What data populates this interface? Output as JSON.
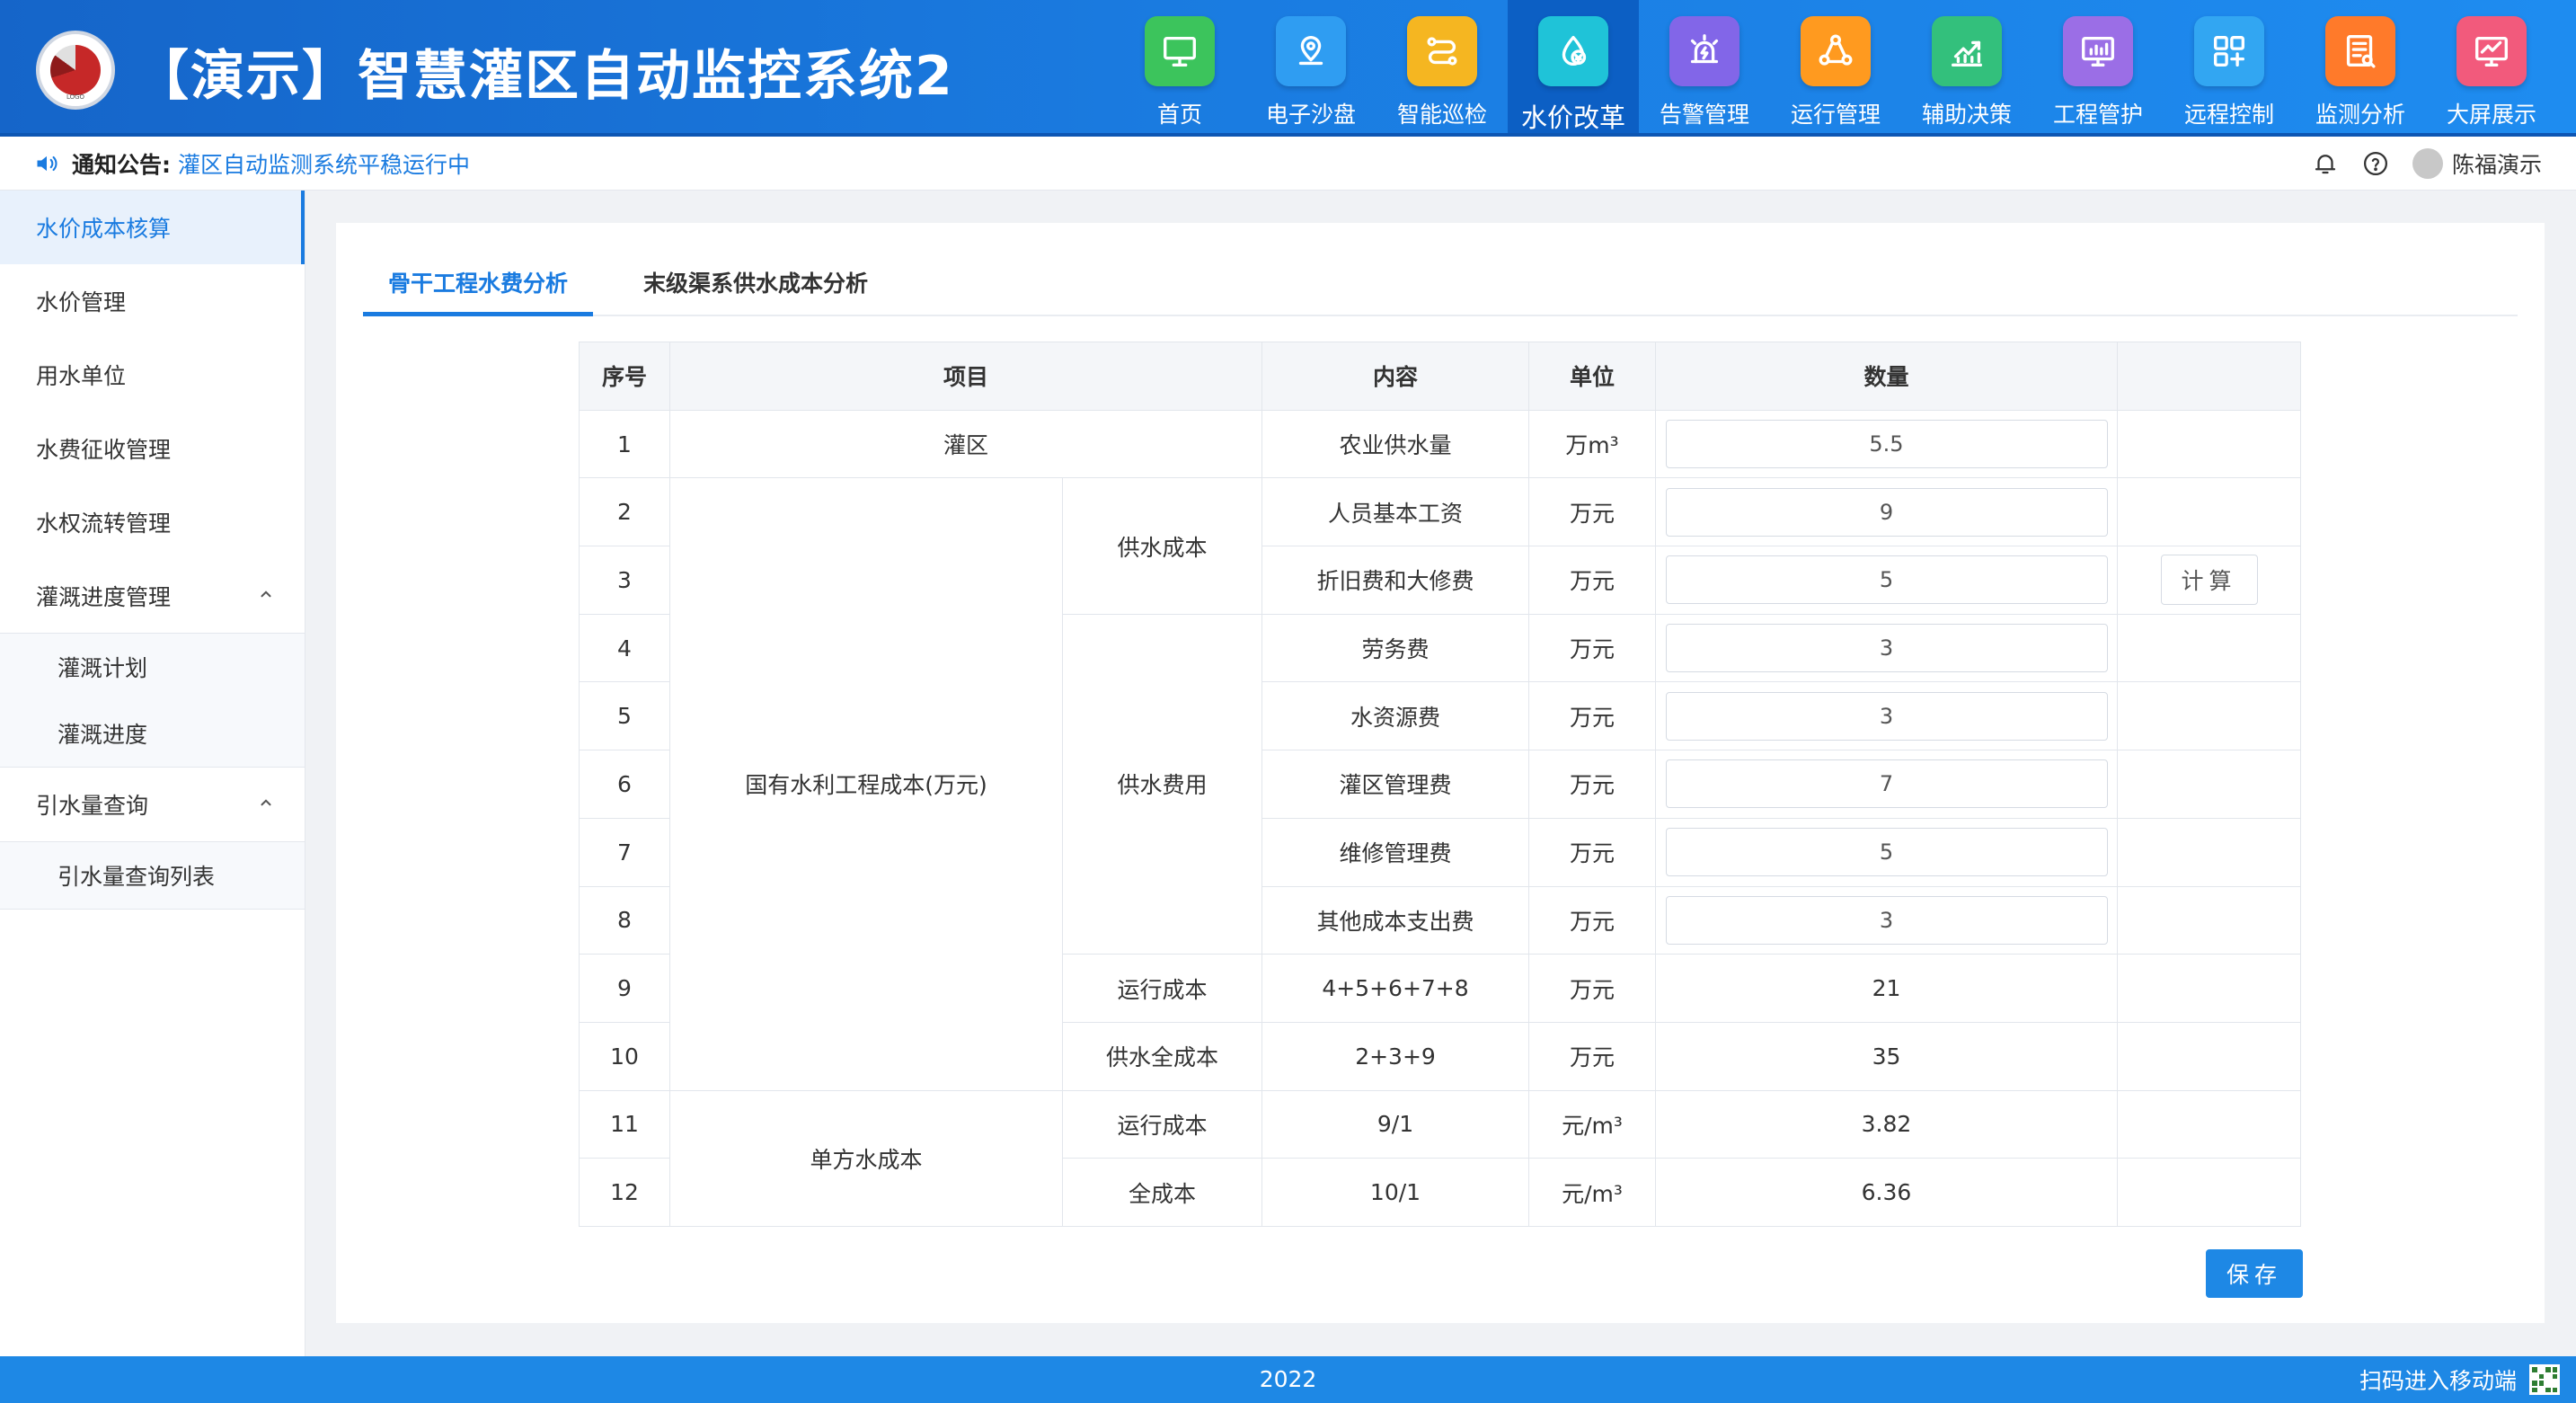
{
  "header": {
    "app_title": "【演示】智慧灌区自动监控系统2",
    "nav": [
      {
        "label": "首页",
        "icon": "monitor-icon",
        "color": "#3cc45c"
      },
      {
        "label": "电子沙盘",
        "icon": "map-pin-icon",
        "color": "#2f9df2"
      },
      {
        "label": "智能巡检",
        "icon": "route-icon",
        "color": "#f5b621"
      },
      {
        "label": "水价改革",
        "icon": "water-price-icon",
        "color": "#1fc3d8",
        "active": true
      },
      {
        "label": "告警管理",
        "icon": "alarm-icon",
        "color": "#8266e8"
      },
      {
        "label": "运行管理",
        "icon": "nodes-icon",
        "color": "#ff9a1f"
      },
      {
        "label": "辅助决策",
        "icon": "chart-up-icon",
        "color": "#33c07c"
      },
      {
        "label": "工程管护",
        "icon": "dashboard-screen-icon",
        "color": "#9b6ee6"
      },
      {
        "label": "远程控制",
        "icon": "remote-control-icon",
        "color": "#32a6f2"
      },
      {
        "label": "监测分析",
        "icon": "report-icon",
        "color": "#ff7a2a"
      },
      {
        "label": "大屏展示",
        "icon": "big-screen-icon",
        "color": "#f25a7c"
      }
    ]
  },
  "notice": {
    "label": "通知公告:",
    "text": "灌区自动监测系统平稳运行中",
    "user": "陈福演示"
  },
  "sidebar": {
    "items": [
      {
        "label": "水价成本核算",
        "active": true
      },
      {
        "label": "水价管理"
      },
      {
        "label": "用水单位"
      },
      {
        "label": "水费征收管理"
      },
      {
        "label": "水权流转管理"
      },
      {
        "label": "灌溉进度管理",
        "expanded": true,
        "children": [
          "灌溉计划",
          "灌溉进度"
        ]
      },
      {
        "label": "引水量查询",
        "expanded": true,
        "children": [
          "引水量查询列表"
        ]
      }
    ]
  },
  "tabs": [
    {
      "label": "骨干工程水费分析",
      "active": true
    },
    {
      "label": "末级渠系供水成本分析"
    }
  ],
  "table": {
    "headers": [
      "序号",
      "项目",
      "内容",
      "单位",
      "数量",
      ""
    ],
    "groups": {
      "irrigation": "灌区",
      "state_cost": "国有水利工程成本(万元)",
      "supply_cost": "供水成本",
      "supply_fee": "供水费用",
      "run_cost": "运行成本",
      "full_cost": "供水全成本",
      "unit_cost": "单方水成本",
      "unit_run": "运行成本",
      "unit_full": "全成本"
    },
    "rows": [
      {
        "no": "1",
        "content": "农业供水量",
        "unit": "万m³",
        "value": "5.5",
        "input": true
      },
      {
        "no": "2",
        "content": "人员基本工资",
        "unit": "万元",
        "value": "9",
        "input": true
      },
      {
        "no": "3",
        "content": "折旧费和大修费",
        "unit": "万元",
        "value": "5",
        "input": true
      },
      {
        "no": "4",
        "content": "劳务费",
        "unit": "万元",
        "value": "3",
        "input": true
      },
      {
        "no": "5",
        "content": "水资源费",
        "unit": "万元",
        "value": "3",
        "input": true
      },
      {
        "no": "6",
        "content": "灌区管理费",
        "unit": "万元",
        "value": "7",
        "input": true
      },
      {
        "no": "7",
        "content": "维修管理费",
        "unit": "万元",
        "value": "5",
        "input": true
      },
      {
        "no": "8",
        "content": "其他成本支出费",
        "unit": "万元",
        "value": "3",
        "input": true
      },
      {
        "no": "9",
        "content": "4+5+6+7+8",
        "unit": "万元",
        "value": "21"
      },
      {
        "no": "10",
        "content": "2+3+9",
        "unit": "万元",
        "value": "35"
      },
      {
        "no": "11",
        "content": "9/1",
        "unit": "元/m³",
        "value": "3.82"
      },
      {
        "no": "12",
        "content": "10/1",
        "unit": "元/m³",
        "value": "6.36"
      }
    ],
    "calc_label": "计算"
  },
  "actions": {
    "save_label": "保存"
  },
  "footer": {
    "year": "2022",
    "mobile_label": "扫码进入移动端"
  }
}
